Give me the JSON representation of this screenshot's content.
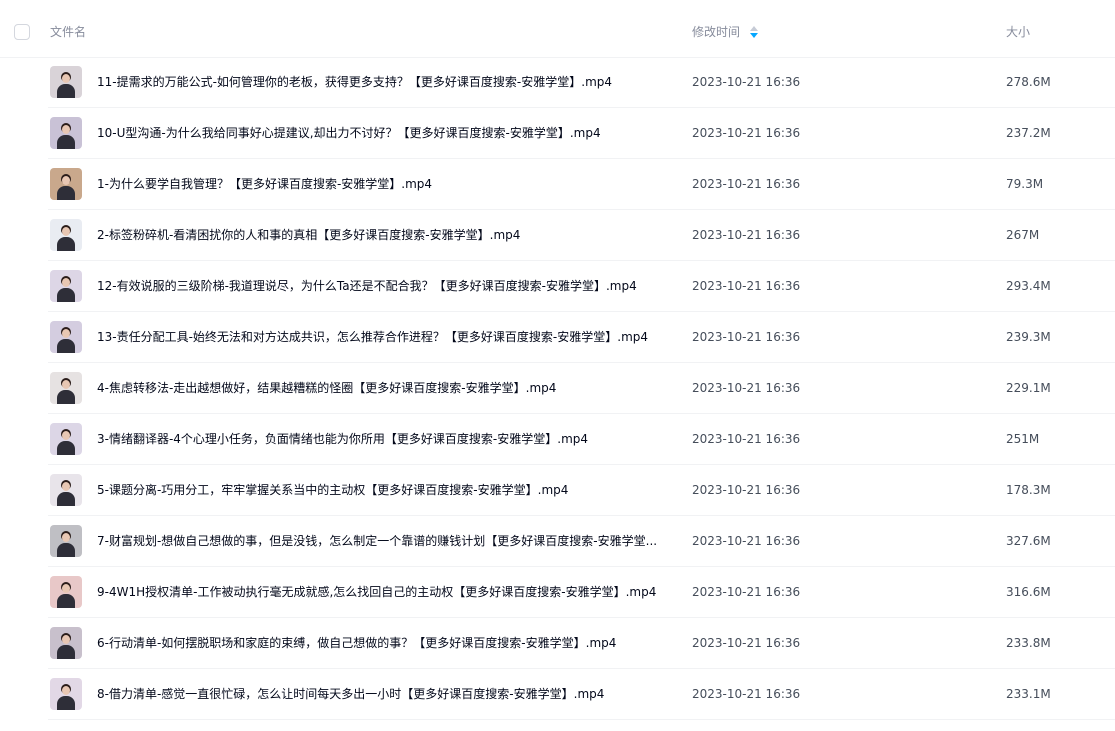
{
  "header": {
    "name_label": "文件名",
    "time_label": "修改时间",
    "size_label": "大小"
  },
  "files": [
    {
      "name": "11-提需求的万能公式-如何管理你的老板，获得更多支持？【更多好课百度搜索-安雅学堂】.mp4",
      "modified": "2023-10-21 16:36",
      "size": "278.6M"
    },
    {
      "name": "10-U型沟通-为什么我给同事好心提建议,却出力不讨好？【更多好课百度搜索-安雅学堂】.mp4",
      "modified": "2023-10-21 16:36",
      "size": "237.2M"
    },
    {
      "name": "1-为什么要学自我管理？【更多好课百度搜索-安雅学堂】.mp4",
      "modified": "2023-10-21 16:36",
      "size": "79.3M"
    },
    {
      "name": "2-标签粉碎机-看清困扰你的人和事的真相【更多好课百度搜索-安雅学堂】.mp4",
      "modified": "2023-10-21 16:36",
      "size": "267M"
    },
    {
      "name": "12-有效说服的三级阶梯-我道理说尽，为什么Ta还是不配合我？【更多好课百度搜索-安雅学堂】.mp4",
      "modified": "2023-10-21 16:36",
      "size": "293.4M"
    },
    {
      "name": "13-责任分配工具-始终无法和对方达成共识，怎么推荐合作进程？【更多好课百度搜索-安雅学堂】.mp4",
      "modified": "2023-10-21 16:36",
      "size": "239.3M"
    },
    {
      "name": "4-焦虑转移法-走出越想做好，结果越糟糕的怪圈【更多好课百度搜索-安雅学堂】.mp4",
      "modified": "2023-10-21 16:36",
      "size": "229.1M"
    },
    {
      "name": "3-情绪翻译器-4个心理小任务，负面情绪也能为你所用【更多好课百度搜索-安雅学堂】.mp4",
      "modified": "2023-10-21 16:36",
      "size": "251M"
    },
    {
      "name": "5-课题分离-巧用分工，牢牢掌握关系当中的主动权【更多好课百度搜索-安雅学堂】.mp4",
      "modified": "2023-10-21 16:36",
      "size": "178.3M"
    },
    {
      "name": "7-财富规划-想做自己想做的事，但是没钱，怎么制定一个靠谱的赚钱计划【更多好课百度搜索-安雅学堂...",
      "modified": "2023-10-21 16:36",
      "size": "327.6M"
    },
    {
      "name": "9-4W1H授权清单-工作被动执行毫无成就感,怎么找回自己的主动权【更多好课百度搜索-安雅学堂】.mp4",
      "modified": "2023-10-21 16:36",
      "size": "316.6M"
    },
    {
      "name": "6-行动清单-如何摆脱职场和家庭的束缚，做自己想做的事？【更多好课百度搜索-安雅学堂】.mp4",
      "modified": "2023-10-21 16:36",
      "size": "233.8M"
    },
    {
      "name": "8-借力清单-感觉一直很忙碌，怎么让时间每天多出一小时【更多好课百度搜索-安雅学堂】.mp4",
      "modified": "2023-10-21 16:36",
      "size": "233.1M"
    }
  ],
  "thumb_colors": [
    "#d9d3d8",
    "#c9c2d6",
    "#c9a88c",
    "#e9ecf2",
    "#ddd6e6",
    "#d4cde0",
    "#e6e2e2",
    "#dcd6e6",
    "#e8e4ea",
    "#bfbfc4",
    "#e8c8c8",
    "#c8c0cc",
    "#e2d8e6"
  ],
  "colors": {
    "sort_up": "#c6cbd6",
    "sort_down": "#06a7ff"
  }
}
